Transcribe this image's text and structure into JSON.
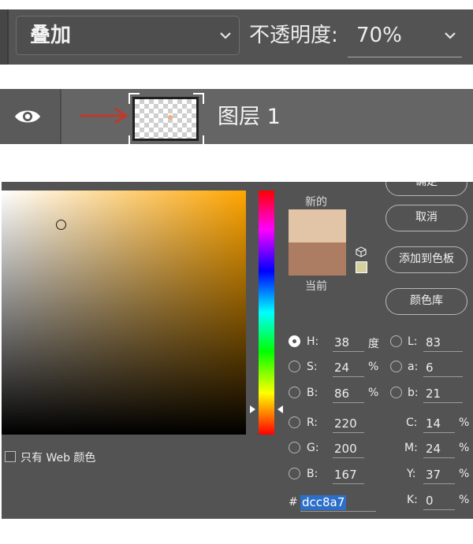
{
  "layer_style_bar": {
    "blend_mode": "叠加",
    "opacity_label": "不透明度:",
    "opacity_value": "70%"
  },
  "layer_row": {
    "layer_name": "图层 1",
    "eye_icon": "eye-icon",
    "arrow_icon": "red-arrow-icon",
    "arrow_color": "#c0392b"
  },
  "color_picker": {
    "new_label": "新的",
    "current_label": "当前",
    "new_color": "#e2c5a6",
    "current_color": "#ad7d63",
    "buttons": {
      "ok": "确定",
      "cancel": "取消",
      "add_to_swatches": "添加到色板",
      "color_libraries": "颜色库"
    },
    "web_only_label": "只有 Web 颜色",
    "hsb": {
      "H": {
        "label": "H:",
        "value": "38",
        "unit": "度"
      },
      "S": {
        "label": "S:",
        "value": "24",
        "unit": "%"
      },
      "B": {
        "label": "B:",
        "value": "86",
        "unit": "%"
      }
    },
    "rgb": {
      "R": {
        "label": "R:",
        "value": "220"
      },
      "G": {
        "label": "G:",
        "value": "200"
      },
      "B": {
        "label": "B:",
        "value": "167"
      }
    },
    "lab": {
      "L": {
        "label": "L:",
        "value": "83"
      },
      "a": {
        "label": "a:",
        "value": "6"
      },
      "b": {
        "label": "b:",
        "value": "21"
      }
    },
    "cmyk": {
      "C": {
        "label": "C:",
        "value": "14",
        "unit": "%"
      },
      "M": {
        "label": "M:",
        "value": "24",
        "unit": "%"
      },
      "Y": {
        "label": "Y:",
        "value": "37",
        "unit": "%"
      },
      "K": {
        "label": "K:",
        "value": "0",
        "unit": "%"
      }
    },
    "hex_prefix": "#",
    "hex_value": "dcc8a7"
  }
}
